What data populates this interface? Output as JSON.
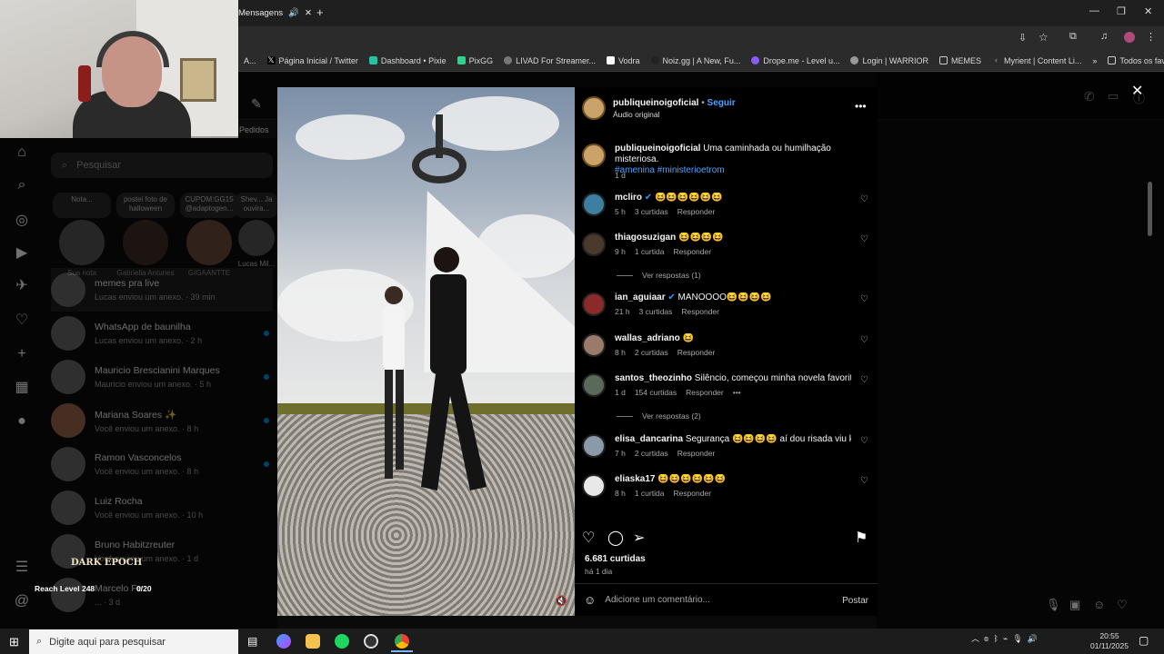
{
  "browser": {
    "tab_title": "Mensagens",
    "bookmarks": [
      "A...",
      "Página Inicial / Twitter",
      "Dashboard • Pixie",
      "PixGG",
      "LIVAD For Streamer...",
      "Vodra",
      "Noiz.gg | A New, Fu...",
      "Drope.me - Level u...",
      "Login | WARRIOR",
      "MEMES",
      "Myrient | Content Li...",
      "Todos os favoritos"
    ]
  },
  "left_nav": {
    "search_placeholder": "Pesquisar",
    "pedidos": "Pedidos",
    "notes": [
      {
        "bubble": "Nota...",
        "name": "Sua nota"
      },
      {
        "bubble": "postei foto de halloween",
        "name": "Gabriella Antunes"
      },
      {
        "bubble": "CUPOM:GG15 @adaptogen...",
        "name": "GIGAANTTE"
      },
      {
        "bubble": "Shev... Ja ouvira...",
        "name": "Lucas Mil..."
      }
    ],
    "chats": [
      {
        "name": "memes pra live",
        "sub": "Lucas enviou um anexo. · 39 min"
      },
      {
        "name": "WhatsApp de baunilha",
        "sub": "Lucas enviou um anexo. · 2 h"
      },
      {
        "name": "Mauricio Brescianini Marques",
        "sub": "Mauricio enviou um anexo. · 5 h"
      },
      {
        "name": "Mariana Soares ✨",
        "sub": "Você enviou um anexo. · 8 h"
      },
      {
        "name": "Ramon Vasconcelos",
        "sub": "Você enviou um anexo. · 8 h"
      },
      {
        "name": "Luiz Rocha",
        "sub": "Você enviou um anexo. · 10 h"
      },
      {
        "name": "Bruno Habitzreuter",
        "sub": "Você enviou um anexo. · 1 d"
      },
      {
        "name": "Marcelo Fe...",
        "sub": "... · 3 d"
      }
    ]
  },
  "overlay": {
    "game": "DARK EPOCH",
    "reach": "Reach Level 248",
    "count": "0/20"
  },
  "post": {
    "username": "publiqueinoigoficial",
    "follow": "Seguir",
    "audio": "Áudio original",
    "caption_user": "publiqueinoigoficial",
    "caption_text": "Uma caminhada ou humilhação misteriosa.",
    "caption_tags": "#amenina #ministerioetrom",
    "caption_age": "1 d",
    "comments": [
      {
        "user": "mcliro",
        "text": "😆😆😆😆😆😆",
        "time": "5 h",
        "likes": "3 curtidas",
        "reply": "Responder"
      },
      {
        "user": "thiagosuzigan",
        "text": "😆😆😆😆",
        "time": "9 h",
        "likes": "1 curtida",
        "reply": "Responder"
      },
      {
        "user": "ian_aguiaar",
        "text": "MANOOOO😆😆😆😆",
        "time": "21 h",
        "likes": "3 curtidas",
        "reply": "Responder"
      },
      {
        "user": "wallas_adriano",
        "text": "😆",
        "time": "8 h",
        "likes": "2 curtidas",
        "reply": "Responder"
      },
      {
        "user": "santos_theozinho",
        "text": "Silêncio, começou minha novela favorita.",
        "time": "1 d",
        "likes": "154 curtidas",
        "reply": "Responder"
      },
      {
        "user": "elisa_dancarina",
        "text": "Segurança 😆😆😆😆 aí dou risada viu kkkkk",
        "time": "7 h",
        "likes": "2 curtidas",
        "reply": "Responder"
      },
      {
        "user": "eliaska17",
        "text": "😆😆😆😆😆😆",
        "time": "8 h",
        "likes": "1 curtida",
        "reply": "Responder"
      }
    ],
    "view_replies_1": "Ver respostas (1)",
    "view_replies_2": "Ver respostas (2)",
    "likes_total": "6.681 curtidas",
    "posted": "há 1 dia",
    "add_comment_placeholder": "Adicione um comentário...",
    "post_button": "Postar"
  },
  "taskbar": {
    "search_placeholder": "Digite aqui para pesquisar",
    "time": "20:55",
    "date": "01/11/2025"
  }
}
